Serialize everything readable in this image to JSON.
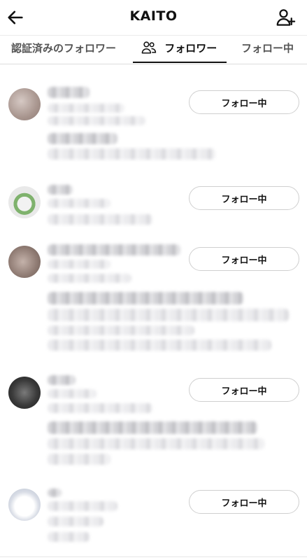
{
  "header": {
    "title": "KAITO",
    "back_icon": "arrow-left-icon",
    "action_icon": "add-user-icon"
  },
  "tabs": [
    {
      "label": "認証済みのフォロワー",
      "selected": false
    },
    {
      "label": "フォロワー",
      "selected": true,
      "icon": "people-icon"
    },
    {
      "label": "フォロー中",
      "selected": false
    }
  ],
  "followers": [
    {
      "follow_label": "フォロー中"
    },
    {
      "follow_label": "フォロー中"
    },
    {
      "follow_label": "フォロー中"
    },
    {
      "follow_label": "フォロー中"
    },
    {
      "follow_label": "フォロー中"
    }
  ]
}
